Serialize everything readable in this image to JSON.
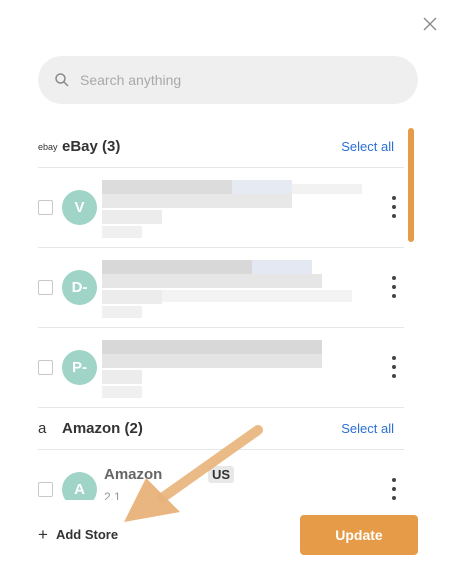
{
  "search": {
    "placeholder": "Search anything"
  },
  "groups": [
    {
      "logo": "ebay",
      "name": "eBay (3)",
      "select_all": "Select all",
      "stores": [
        {
          "initial": "V"
        },
        {
          "initial": "D-"
        },
        {
          "initial": "P-"
        }
      ]
    },
    {
      "logo": "a",
      "name": "Amazon (2)",
      "select_all": "Select all",
      "stores": [
        {
          "initial": "A",
          "name": "Amazon",
          "region": "US",
          "meta": "2.1"
        }
      ]
    }
  ],
  "footer": {
    "add_store": "Add Store",
    "add_icon": "+",
    "update": "Update"
  },
  "colors": {
    "accent": "#e59b47",
    "avatar": "#9fd4c7",
    "link": "#2a6fd6"
  }
}
